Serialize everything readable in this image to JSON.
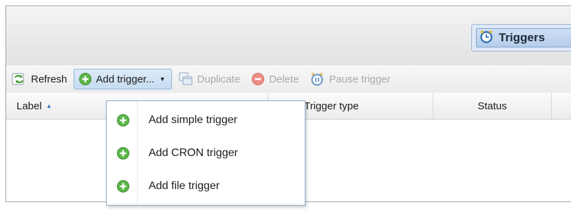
{
  "header": {
    "tab": {
      "label": "Triggers",
      "icon": "alarm-clock-icon"
    }
  },
  "toolbar": {
    "refresh": {
      "label": "Refresh",
      "icon": "refresh-icon"
    },
    "add_trigger": {
      "label": "Add trigger...",
      "icon": "add-icon"
    },
    "duplicate": {
      "label": "Duplicate",
      "icon": "duplicate-icon",
      "disabled": true
    },
    "delete": {
      "label": "Delete",
      "icon": "delete-icon",
      "disabled": true
    },
    "pause": {
      "label": "Pause trigger",
      "icon": "pause-clock-icon",
      "disabled": true
    }
  },
  "grid": {
    "columns": [
      {
        "label": "Label",
        "sort": "ascending"
      },
      {
        "label": "Trigger type"
      },
      {
        "label": "Status"
      }
    ]
  },
  "dropdown": {
    "items": [
      {
        "label": "Add simple trigger",
        "icon": "add-icon"
      },
      {
        "label": "Add CRON trigger",
        "icon": "add-icon"
      },
      {
        "label": "Add file trigger",
        "icon": "add-icon"
      }
    ]
  },
  "colors": {
    "add_green": "#5cb64a",
    "delete_red": "#e8473b",
    "accent_blue": "#3d78c0"
  }
}
